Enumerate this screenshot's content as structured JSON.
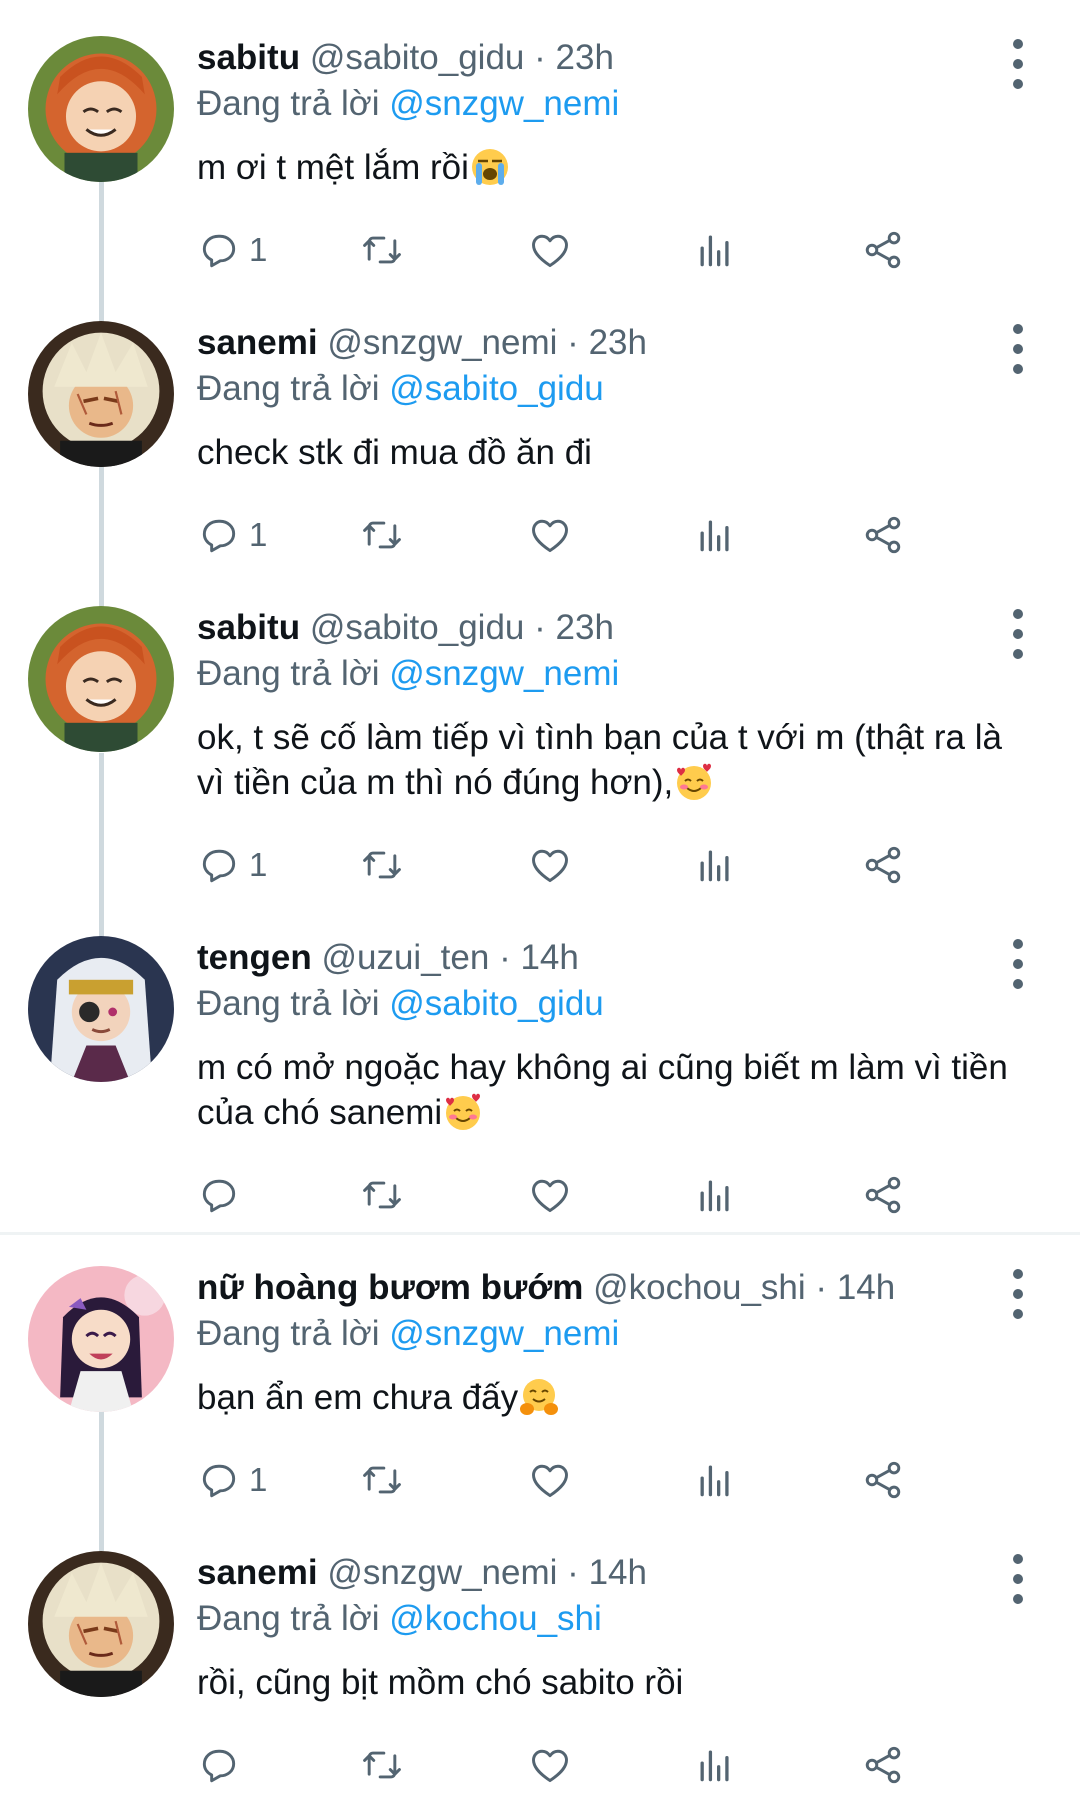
{
  "reply_prefix": "Đang trả lời",
  "tweets": [
    {
      "name": "sabitu",
      "handle": "@sabito_gidu",
      "sep": "·",
      "time": "23h",
      "reply_to": "@snzgw_nemi",
      "text": "m ơi t mệt lắm rồi",
      "emoji": "loudly-crying-face-emoji",
      "replies": "1",
      "avatar": "sabito-avatar"
    },
    {
      "name": "sanemi",
      "handle": "@snzgw_nemi",
      "sep": "·",
      "time": "23h",
      "reply_to": "@sabito_gidu",
      "text": "check stk đi mua đồ ăn đi",
      "emoji": "",
      "replies": "1",
      "avatar": "sanemi-avatar"
    },
    {
      "name": "sabitu",
      "handle": "@sabito_gidu",
      "sep": "·",
      "time": "23h",
      "reply_to": "@snzgw_nemi",
      "text": "ok, t sẽ cố làm tiếp vì tình bạn của t với m (thật ra là vì tiền của m thì nó đúng hơn),",
      "emoji": "smiling-face-with-hearts-emoji",
      "replies": "1",
      "avatar": "sabito-avatar"
    },
    {
      "name": "tengen",
      "handle": "@uzui_ten",
      "sep": "·",
      "time": "14h",
      "reply_to": "@sabito_gidu",
      "text": "m có mở ngoặc hay không ai cũng biết m làm vì tiền của chó sanemi",
      "emoji": "smiling-face-with-hearts-emoji",
      "replies": "",
      "avatar": "tengen-avatar"
    },
    {
      "name": "nữ hoàng bươm bướm",
      "handle": "@kochou_shi",
      "sep": "·",
      "time": "14h",
      "reply_to": "@snzgw_nemi",
      "text": "bạn ẩn em chưa đấy",
      "emoji": "hugging-face-emoji",
      "replies": "1",
      "avatar": "shinobu-avatar"
    },
    {
      "name": "sanemi",
      "handle": "@snzgw_nemi",
      "sep": "·",
      "time": "14h",
      "reply_to": "@kochou_shi",
      "text": "rồi, cũng bịt mồm chó sabito rồi",
      "emoji": "",
      "replies": "",
      "avatar": "sanemi-avatar"
    }
  ],
  "action_icons": [
    "reply-icon",
    "retweet-icon",
    "like-icon",
    "views-icon",
    "share-icon"
  ],
  "colors": {
    "accent": "#1d9bf0",
    "muted": "#536471",
    "text": "#0f1419",
    "thread": "#cfd9de"
  }
}
